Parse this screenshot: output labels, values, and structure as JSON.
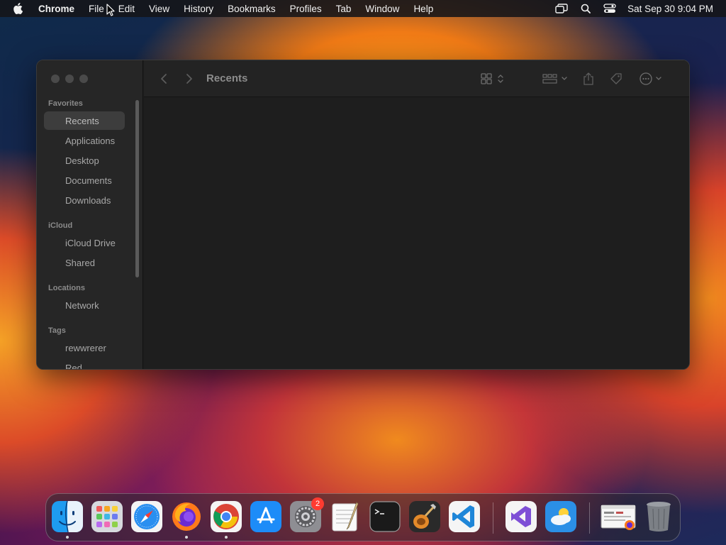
{
  "menubar": {
    "app_name": "Chrome",
    "items": [
      "File",
      "Edit",
      "View",
      "History",
      "Bookmarks",
      "Profiles",
      "Tab",
      "Window",
      "Help"
    ],
    "clock": "Sat Sep 30  9:04 PM"
  },
  "window": {
    "title": "Recents",
    "sidebar": {
      "sections": {
        "favorites": "Favorites",
        "icloud": "iCloud",
        "locations": "Locations",
        "tags": "Tags"
      },
      "favorites": [
        "Recents",
        "Applications",
        "Desktop",
        "Documents",
        "Downloads"
      ],
      "icloud": [
        "iCloud Drive",
        "Shared"
      ],
      "locations": [
        "Network"
      ],
      "tags": [
        "rewwrerer",
        "Red"
      ]
    }
  },
  "dock": {
    "apps": [
      {
        "name": "finder-icon",
        "running": true
      },
      {
        "name": "launchpad-icon",
        "running": false
      },
      {
        "name": "safari-icon",
        "running": false
      },
      {
        "name": "firefox-icon",
        "running": true
      },
      {
        "name": "chrome-icon",
        "running": true
      },
      {
        "name": "app-store-icon",
        "running": false
      },
      {
        "name": "system-settings-icon",
        "running": false,
        "badge": "2"
      },
      {
        "name": "textedit-icon",
        "running": false
      },
      {
        "name": "terminal-icon",
        "running": false
      },
      {
        "name": "garageband-icon",
        "running": false
      },
      {
        "name": "vscode-icon",
        "running": false
      },
      {
        "name": "visual-studio-icon",
        "running": false
      },
      {
        "name": "weather-icon",
        "running": false
      },
      {
        "name": "recent-window-thumbnail",
        "running": false
      },
      {
        "name": "trash-icon",
        "running": false
      }
    ]
  },
  "colors": {
    "menubar_bg": "#141418",
    "window_bg": "#1e1e1e",
    "sidebar_bg": "#262626",
    "badge": "#ff3b30"
  }
}
